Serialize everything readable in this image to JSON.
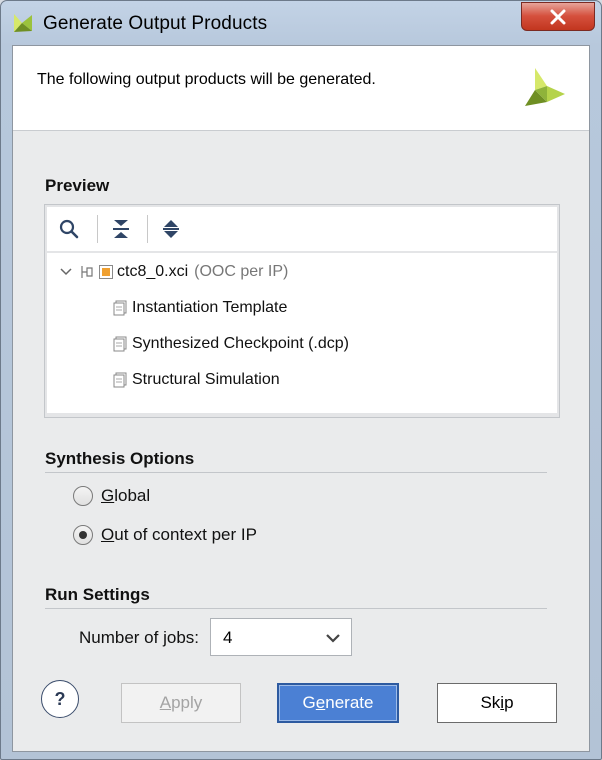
{
  "window": {
    "title": "Generate Output Products"
  },
  "header": {
    "text": "The following output products will be generated."
  },
  "preview": {
    "title": "Preview",
    "toolbar": {
      "search_icon": "search-icon",
      "collapse_icon": "collapse-all-icon",
      "expand_icon": "expand-all-icon"
    },
    "tree": {
      "root": {
        "name": "ctc8_0.xci",
        "suffix": "(OOC per IP)"
      },
      "children": [
        {
          "label": "Instantiation Template"
        },
        {
          "label": "Synthesized Checkpoint (.dcp)"
        },
        {
          "label": "Structural Simulation"
        }
      ]
    }
  },
  "synthesis": {
    "title": "Synthesis Options",
    "options": [
      {
        "mnemonic": "G",
        "rest": "lobal",
        "checked": false
      },
      {
        "mnemonic": "O",
        "rest": "ut of context per IP",
        "checked": true
      }
    ]
  },
  "run": {
    "title": "Run Settings",
    "jobs_label": "Number of jobs:",
    "jobs_value": "4"
  },
  "buttons": {
    "help": "?",
    "apply": {
      "mnemonic": "A",
      "rest": "pply"
    },
    "generate": {
      "pre": "G",
      "mnemonic": "e",
      "rest": "nerate"
    },
    "skip": {
      "pre": "Sk",
      "mnemonic": "i",
      "rest": "p"
    }
  },
  "colors": {
    "primary_button": "#4b80d4",
    "close_button": "#d5503d",
    "xilinx_green": "#8bc34a"
  }
}
